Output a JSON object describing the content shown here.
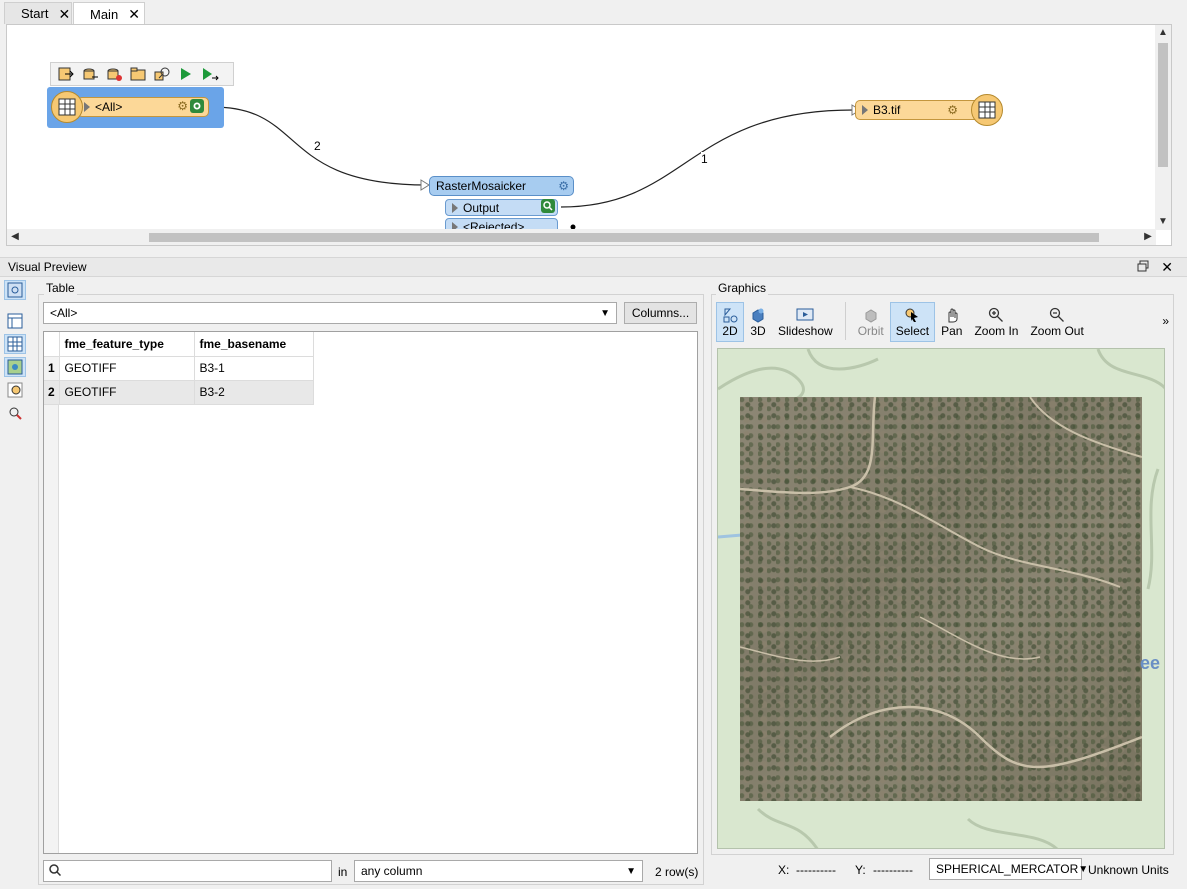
{
  "tabs": [
    {
      "label": "Start",
      "close": "✕"
    },
    {
      "label": "Main",
      "close": "✕"
    }
  ],
  "canvas": {
    "reader_node": {
      "label": "<All>"
    },
    "writer_node": {
      "label": "B3.tif"
    },
    "transformer": {
      "label": "RasterMosaicker",
      "ports": [
        "Output",
        "<Rejected>"
      ]
    },
    "connection_counts": [
      "2",
      "1"
    ]
  },
  "visual_preview": {
    "title": "Visual Preview",
    "table_group": {
      "label": "Table",
      "feature_type_selected": "<All>",
      "columns_button": "Columns...",
      "columns": [
        "fme_feature_type",
        "fme_basename"
      ],
      "rows": [
        {
          "num": "1",
          "values": [
            "GEOTIFF",
            "B3-1"
          ]
        },
        {
          "num": "2",
          "values": [
            "GEOTIFF",
            "B3-2"
          ]
        }
      ],
      "search": {
        "value": "",
        "in_label": "in",
        "scope": "any column"
      },
      "row_count": "2 row(s)"
    },
    "graphics_group": {
      "label": "Graphics",
      "tools": [
        {
          "label": "2D",
          "icon": "2d-view-icon",
          "state": "on"
        },
        {
          "label": "3D",
          "icon": "3d-view-icon",
          "state": "normal"
        },
        {
          "label": "Slideshow",
          "icon": "slideshow-icon",
          "state": "normal"
        },
        {
          "label": "Orbit",
          "icon": "orbit-icon",
          "state": "disabled"
        },
        {
          "label": "Select",
          "icon": "select-icon",
          "state": "on"
        },
        {
          "label": "Pan",
          "icon": "pan-hand-icon",
          "state": "normal"
        },
        {
          "label": "Zoom In",
          "icon": "zoom-in-icon",
          "state": "normal"
        },
        {
          "label": "Zoom Out",
          "icon": "zoom-out-icon",
          "state": "normal"
        }
      ],
      "more": "»",
      "map_label": "ee",
      "coords": {
        "x_label": "X:",
        "x_value": "----------",
        "y_label": "Y:",
        "y_value": "----------"
      },
      "coord_system": "SPHERICAL_MERCATOR",
      "units": "Unknown Units"
    }
  }
}
